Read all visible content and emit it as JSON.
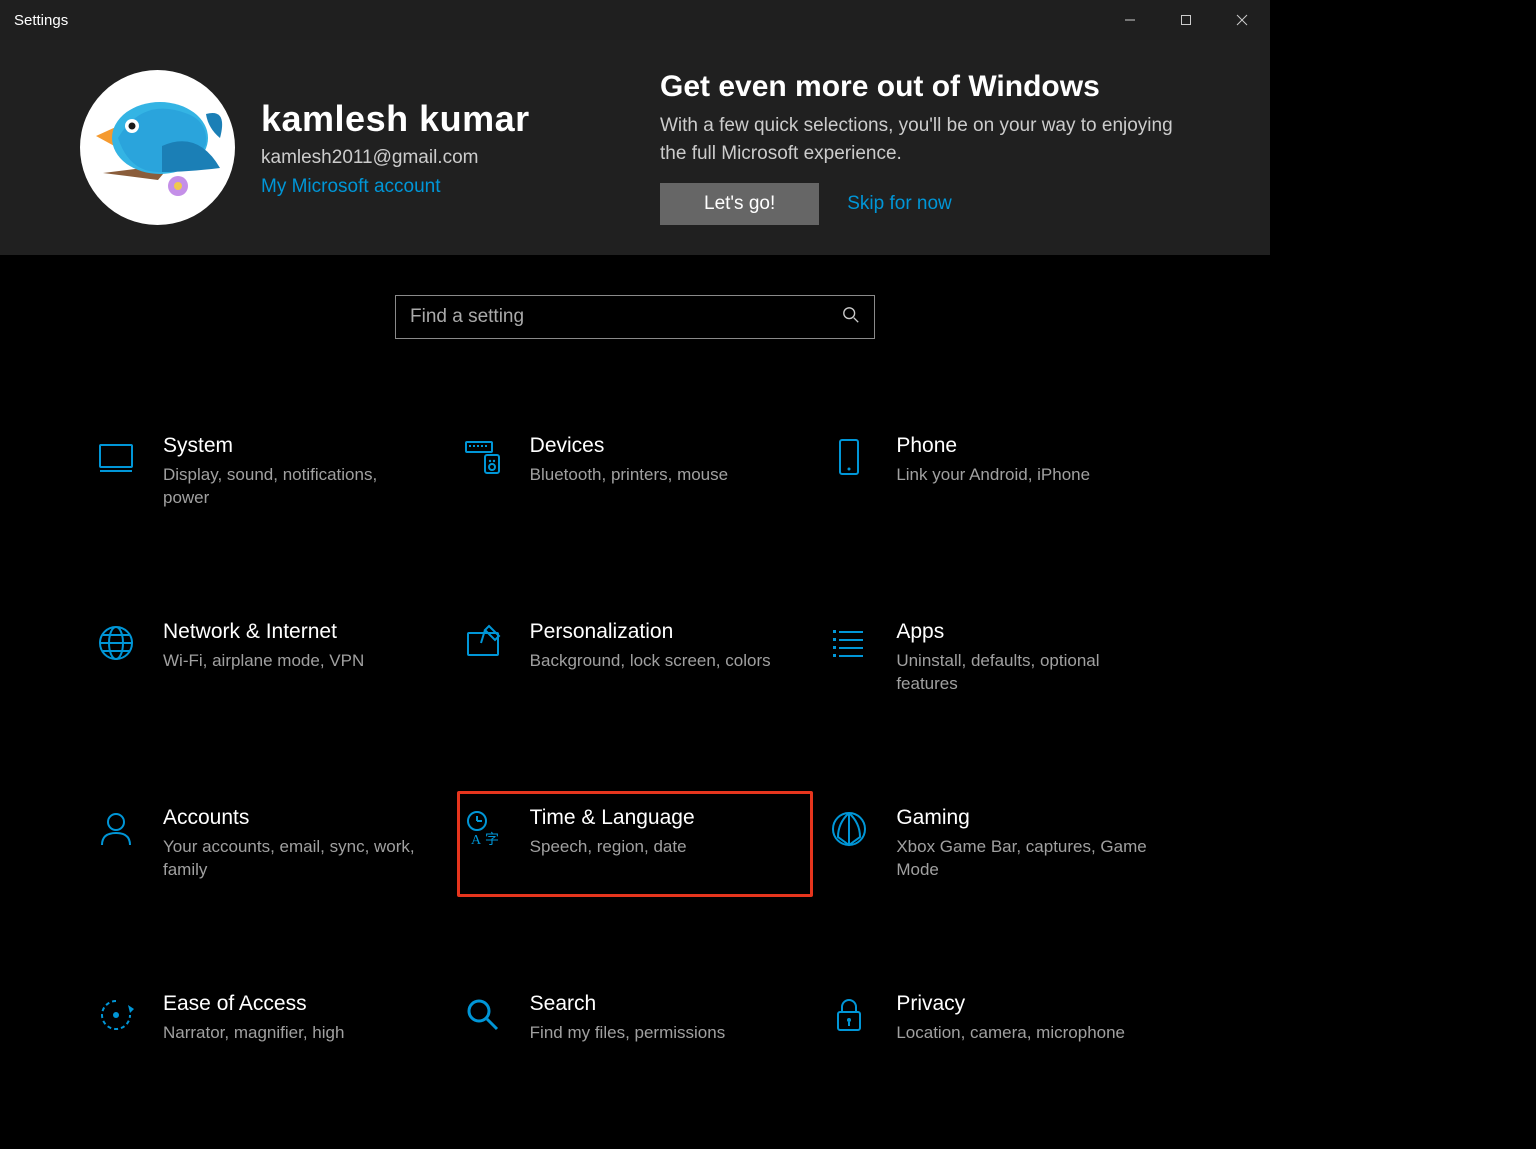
{
  "window": {
    "title": "Settings"
  },
  "profile": {
    "name": "kamlesh kumar",
    "email": "kamlesh2011@gmail.com",
    "link": "My Microsoft account"
  },
  "promo": {
    "title": "Get even more out of Windows",
    "subtitle": "With a few quick selections, you'll be on your way to enjoying the full Microsoft experience.",
    "cta": "Let's go!",
    "skip": "Skip for now"
  },
  "search": {
    "placeholder": "Find a setting"
  },
  "categories": [
    {
      "id": "system",
      "title": "System",
      "desc": "Display, sound, notifications, power"
    },
    {
      "id": "devices",
      "title": "Devices",
      "desc": "Bluetooth, printers, mouse"
    },
    {
      "id": "phone",
      "title": "Phone",
      "desc": "Link your Android, iPhone"
    },
    {
      "id": "network",
      "title": "Network & Internet",
      "desc": "Wi-Fi, airplane mode, VPN"
    },
    {
      "id": "personalization",
      "title": "Personalization",
      "desc": "Background, lock screen, colors"
    },
    {
      "id": "apps",
      "title": "Apps",
      "desc": "Uninstall, defaults, optional features"
    },
    {
      "id": "accounts",
      "title": "Accounts",
      "desc": "Your accounts, email, sync, work, family"
    },
    {
      "id": "time-language",
      "title": "Time & Language",
      "desc": "Speech, region, date",
      "highlighted": true
    },
    {
      "id": "gaming",
      "title": "Gaming",
      "desc": "Xbox Game Bar, captures, Game Mode"
    },
    {
      "id": "ease-of-access",
      "title": "Ease of Access",
      "desc": "Narrator, magnifier, high"
    },
    {
      "id": "search",
      "title": "Search",
      "desc": "Find my files, permissions"
    },
    {
      "id": "privacy",
      "title": "Privacy",
      "desc": "Location, camera, microphone"
    }
  ]
}
